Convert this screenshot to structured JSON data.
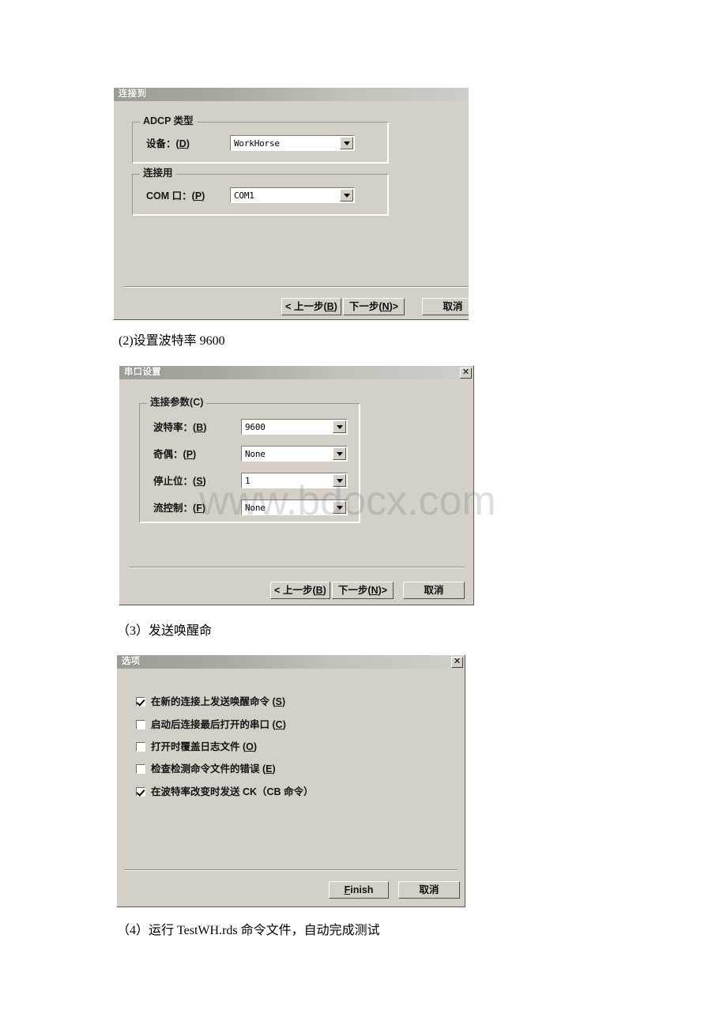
{
  "page": {
    "watermark": "www.bdocx.com",
    "background": "#ffffff"
  },
  "dialog_connect": {
    "title": "连接到",
    "groups": {
      "adcp_type": {
        "legend": "ADCP 类型",
        "device_label": "设备：",
        "device_mnemonic": "D",
        "device_value": "WorkHorse"
      },
      "connect_using": {
        "legend": "连接用",
        "com_label": "COM 口：",
        "com_mnemonic": "P",
        "com_value": "COM1"
      }
    },
    "buttons": {
      "back": "< 上一步",
      "back_mnemonic": "B",
      "next": "下一步",
      "next_mnemonic": "N",
      "next_suffix": " >",
      "cancel": "取消"
    }
  },
  "caption_2": "(2)设置波特率 9600",
  "dialog_serial": {
    "title": "串口设置",
    "close_icon": "✕",
    "group": {
      "legend": "连接参数",
      "legend_mnemonic": "C",
      "fields": [
        {
          "label": "波特率：",
          "mnemonic": "B",
          "value": "9600"
        },
        {
          "label": "奇偶：",
          "mnemonic": "P",
          "value": "None"
        },
        {
          "label": "停止位：",
          "mnemonic": "S",
          "value": "1"
        },
        {
          "label": "流控制：",
          "mnemonic": "F",
          "value": "None"
        }
      ]
    },
    "buttons": {
      "back": "< 上一步",
      "back_mnemonic": "B",
      "next": "下一步",
      "next_mnemonic": "N",
      "next_suffix": " >",
      "cancel": "取消"
    }
  },
  "caption_3": "（3）发送唤醒命",
  "dialog_options": {
    "title": "选项",
    "close_icon": "✕",
    "checkboxes": [
      {
        "label": "在新的连接上发送唤醒命令",
        "mnemonic": "S",
        "checked": true
      },
      {
        "label": "启动后连接最后打开的串口",
        "mnemonic": "C",
        "checked": false
      },
      {
        "label": "打开时覆盖日志文件",
        "mnemonic": "O",
        "checked": false
      },
      {
        "label": "检查检测命令文件的错误",
        "mnemonic": "E",
        "checked": false
      },
      {
        "label": "在波特率改变时发送 CK（CB 命令）",
        "mnemonic": "",
        "checked": true
      }
    ],
    "buttons": {
      "finish": "Finish",
      "finish_mnemonic": "F",
      "cancel": "取消"
    }
  },
  "caption_4": "（4）运行 TestWH.rds 命令文件，自动完成测试"
}
